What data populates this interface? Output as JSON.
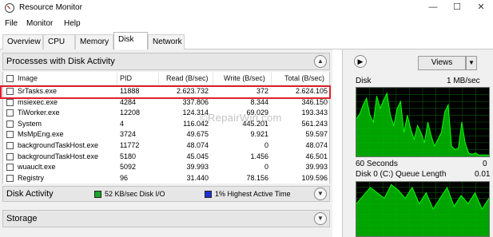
{
  "window": {
    "title": "Resource Monitor",
    "controls": {
      "minimize": "—",
      "maximize": "☐",
      "close": "✕"
    }
  },
  "menu": [
    "File",
    "Monitor",
    "Help"
  ],
  "tabs": [
    "Overview",
    "CPU",
    "Memory",
    "Disk",
    "Network"
  ],
  "active_tab": "Disk",
  "processes_section": {
    "title": "Processes with Disk Activity",
    "columns": [
      "Image",
      "PID",
      "Read (B/sec)",
      "Write (B/sec)",
      "Total (B/sec)"
    ],
    "rows": [
      {
        "image": "SrTasks.exe",
        "pid": "11888",
        "read": "2.623.732",
        "write": "372",
        "total": "2.624.105"
      },
      {
        "image": "msiexec.exe",
        "pid": "4284",
        "read": "337.806",
        "write": "8.344",
        "total": "346.150"
      },
      {
        "image": "TiWorker.exe",
        "pid": "12208",
        "read": "124.314",
        "write": "69.029",
        "total": "193.343"
      },
      {
        "image": "System",
        "pid": "4",
        "read": "116.042",
        "write": "445.201",
        "total": "561.243"
      },
      {
        "image": "MsMpEng.exe",
        "pid": "3724",
        "read": "49.675",
        "write": "9.921",
        "total": "59.597"
      },
      {
        "image": "backgroundTaskHost.exe",
        "pid": "11772",
        "read": "48.074",
        "write": "0",
        "total": "48.074"
      },
      {
        "image": "backgroundTaskHost.exe",
        "pid": "5180",
        "read": "45.045",
        "write": "1.456",
        "total": "46.501"
      },
      {
        "image": "wuauclt.exe",
        "pid": "5092",
        "read": "39.993",
        "write": "0",
        "total": "39.993"
      },
      {
        "image": "Registry",
        "pid": "96",
        "read": "31.440",
        "write": "78.156",
        "total": "109.596"
      }
    ]
  },
  "disk_activity": {
    "title": "Disk Activity",
    "io_label": "52 KB/sec Disk I/O",
    "active_label": "1% Highest Active Time",
    "io_color": "#1aa52a",
    "active_color": "#1c2fd8"
  },
  "storage": {
    "title": "Storage"
  },
  "watermark": "©RepairWin.com",
  "right_panel": {
    "views_label": "Views",
    "graph1": {
      "title": "Disk",
      "scale": "1 MB/sec",
      "footer": "60 Seconds",
      "footer_value": "0",
      "levels": [
        0.55,
        0.62,
        0.75,
        0.85,
        0.6,
        0.5,
        0.88,
        0.7,
        0.82,
        0.92,
        0.6,
        0.45,
        0.7,
        0.8,
        0.35,
        0.6,
        0.4,
        0.25,
        0.45,
        0.35,
        0.2,
        0.5,
        0.3,
        0.15,
        0.25,
        0.35,
        0.65,
        0.75,
        0.15,
        0.1,
        0.12,
        0.5,
        0.2,
        0.05,
        0.03,
        0.05,
        0.02,
        0.02,
        0.02,
        0.02
      ]
    },
    "graph2": {
      "title": "Disk 0 (C:) Queue Length",
      "scale": "0.01",
      "levels": [
        0.6,
        0.75,
        0.9,
        0.8,
        0.7,
        0.95,
        0.85,
        0.7,
        0.9,
        0.6,
        0.8,
        0.5,
        0.7,
        0.9,
        0.55,
        0.75,
        0.6,
        0.8,
        0.5,
        0.7
      ]
    },
    "graph_color": "#00c000",
    "grid_color": "#0a5a0a"
  }
}
